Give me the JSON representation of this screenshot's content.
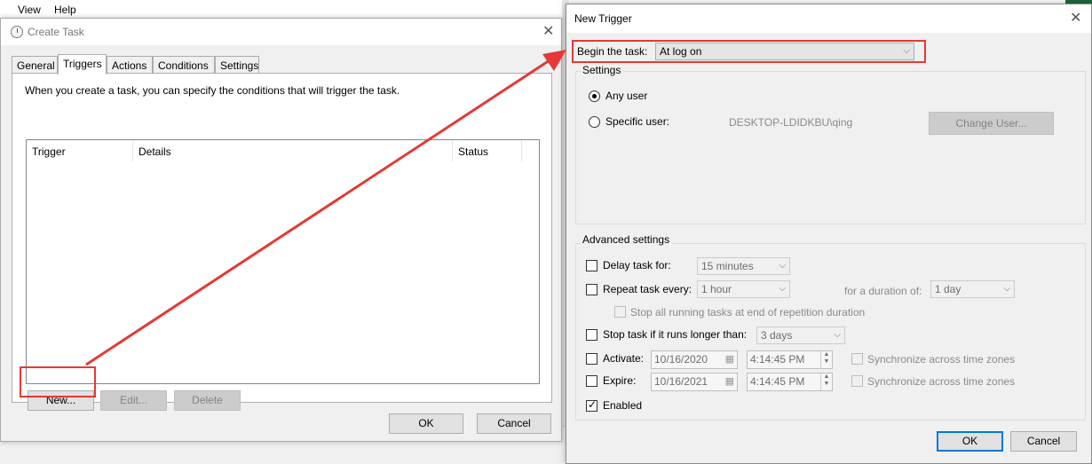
{
  "background_app": {
    "menu_view": "View",
    "menu_help": "Help"
  },
  "create_task": {
    "title": "Create Task",
    "tabs": [
      "General",
      "Triggers",
      "Actions",
      "Conditions",
      "Settings"
    ],
    "active_tab": "Triggers",
    "description": "When you create a task, you can specify the conditions that will trigger the task.",
    "columns": [
      "Trigger",
      "Details",
      "Status"
    ],
    "buttons": {
      "new": "New...",
      "edit": "Edit...",
      "delete": "Delete",
      "ok": "OK",
      "cancel": "Cancel"
    }
  },
  "new_trigger": {
    "title": "New Trigger",
    "begin_label": "Begin the task:",
    "begin_value": "At log on",
    "settings_group": "Settings",
    "any_user": "Any user",
    "specific_user": "Specific user:",
    "user_name": "DESKTOP-LDIDKBU\\qing",
    "change_user": "Change User...",
    "advanced_group": "Advanced settings",
    "delay_label": "Delay task for:",
    "delay_value": "15 minutes",
    "repeat_label": "Repeat task every:",
    "repeat_value": "1 hour",
    "duration_label": "for a duration of:",
    "duration_value": "1 day",
    "stop_all_label": "Stop all running tasks at end of repetition duration",
    "stop_longer_label": "Stop task if it runs longer than:",
    "stop_longer_value": "3 days",
    "activate_label": "Activate:",
    "activate_date": "10/16/2020",
    "activate_time": "4:14:45 PM",
    "expire_label": "Expire:",
    "expire_date": "10/16/2021",
    "expire_time": "4:14:45 PM",
    "sync_label": "Synchronize across time zones",
    "enabled_label": "Enabled",
    "ok": "OK",
    "cancel": "Cancel"
  },
  "colors": {
    "highlight": "#e53935",
    "accent": "#0078d7"
  }
}
